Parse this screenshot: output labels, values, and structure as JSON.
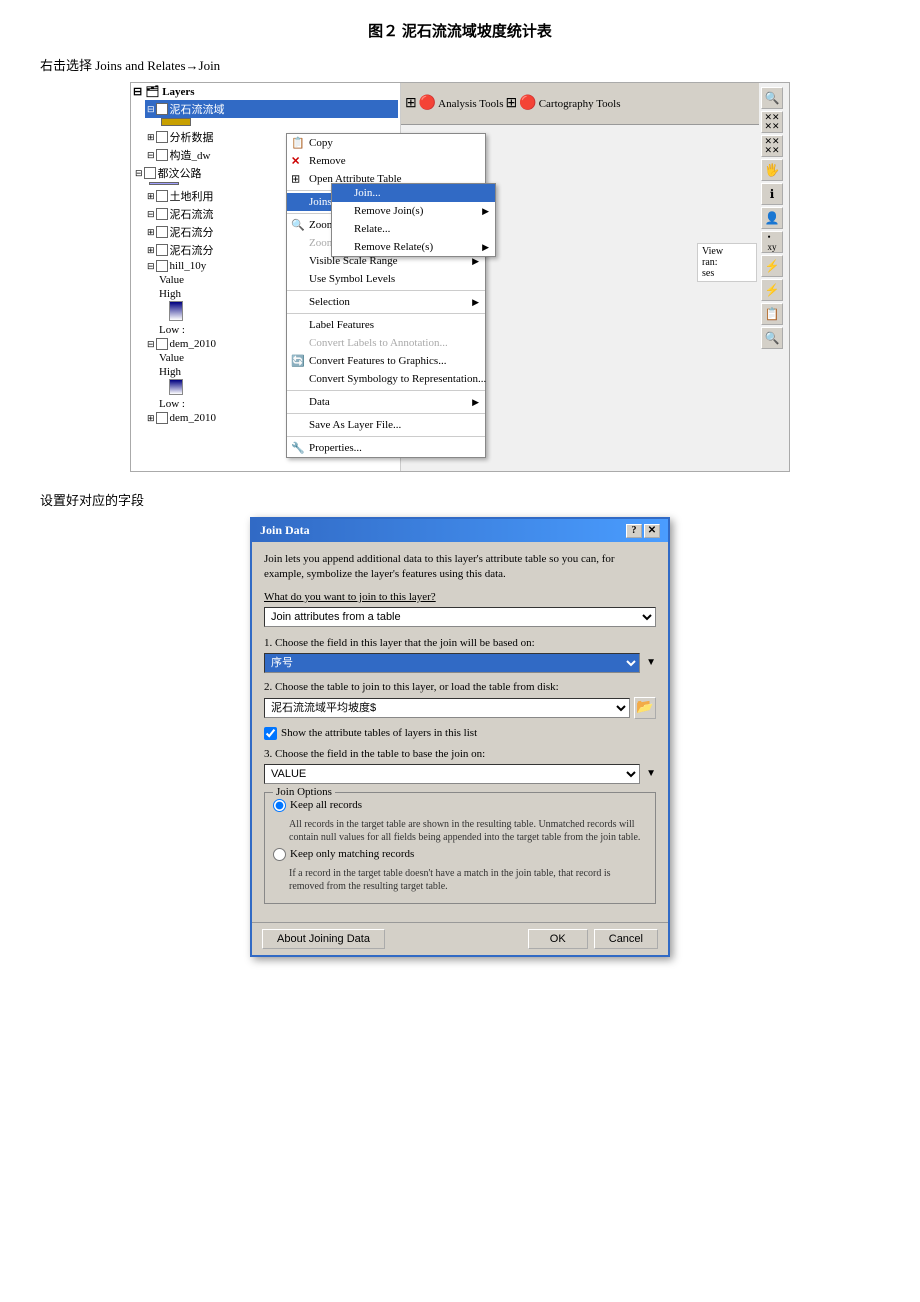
{
  "page": {
    "title": "图２ 泥石流流域坡度统计表",
    "section1_label": "右击选择 Joins and Relates→Join",
    "section2_label": "设置好对应的字段"
  },
  "layers_panel": {
    "title": "Layers",
    "items": [
      {
        "label": "泥石流流域",
        "indent": 1,
        "checked": true,
        "selected": true,
        "type": "layer"
      },
      {
        "label": "分析数据",
        "indent": 1,
        "checked": false,
        "type": "layer"
      },
      {
        "label": "构造_dw",
        "indent": 1,
        "checked": false,
        "type": "layer"
      },
      {
        "label": "都汶公路",
        "indent": 0,
        "checked": false,
        "type": "layer"
      },
      {
        "label": "土地利用",
        "indent": 1,
        "checked": false,
        "type": "layer"
      },
      {
        "label": "泥石流流",
        "indent": 1,
        "checked": false,
        "type": "layer"
      },
      {
        "label": "泥石流分",
        "indent": 1,
        "checked": false,
        "type": "layer"
      },
      {
        "label": "泥石流分",
        "indent": 1,
        "checked": false,
        "type": "layer"
      },
      {
        "label": "hill_10y",
        "indent": 1,
        "checked": false,
        "type": "layer"
      },
      {
        "label": "Value",
        "indent": 2,
        "type": "info"
      },
      {
        "label": "High",
        "indent": 2,
        "type": "info"
      },
      {
        "label": "Low :",
        "indent": 2,
        "type": "info"
      },
      {
        "label": "dem_2010",
        "indent": 1,
        "checked": false,
        "type": "layer"
      },
      {
        "label": "Value",
        "indent": 2,
        "type": "info"
      },
      {
        "label": "High",
        "indent": 2,
        "type": "info"
      },
      {
        "label": "Low :",
        "indent": 2,
        "type": "info"
      },
      {
        "label": "dem_2010",
        "indent": 1,
        "checked": false,
        "type": "layer"
      }
    ]
  },
  "context_menu": {
    "items": [
      {
        "label": "Copy",
        "icon": "📋",
        "disabled": false
      },
      {
        "label": "Remove",
        "icon": "✕",
        "disabled": false
      },
      {
        "label": "Open Attribute Table",
        "icon": "⊞",
        "disabled": false
      },
      {
        "label": "Joins and Relates",
        "icon": "",
        "disabled": false,
        "active": true,
        "has_submenu": true
      },
      {
        "label": "Zoom To Layer",
        "icon": "🔍",
        "disabled": false
      },
      {
        "label": "Zoom To Make Visible",
        "icon": "",
        "disabled": true
      },
      {
        "label": "Visible Scale Range",
        "icon": "",
        "disabled": false,
        "has_submenu": true
      },
      {
        "label": "Use Symbol Levels",
        "icon": "",
        "disabled": false
      },
      {
        "label": "Selection",
        "icon": "",
        "disabled": false,
        "has_submenu": true
      },
      {
        "label": "Label Features",
        "icon": "",
        "disabled": false
      },
      {
        "label": "Convert Labels to Annotation...",
        "icon": "",
        "disabled": true
      },
      {
        "label": "Convert Features to Graphics...",
        "icon": "🔄",
        "disabled": false
      },
      {
        "label": "Convert Symbology to Representation...",
        "icon": "",
        "disabled": false
      },
      {
        "label": "Data",
        "icon": "",
        "disabled": false,
        "has_submenu": true
      },
      {
        "label": "Save As Layer File...",
        "icon": "",
        "disabled": false
      },
      {
        "label": "Properties...",
        "icon": "🔧",
        "disabled": false
      }
    ]
  },
  "submenu": {
    "items": [
      {
        "label": "Join...",
        "active": true
      },
      {
        "label": "Remove Join(s)",
        "has_submenu": true
      },
      {
        "label": "Relate..."
      },
      {
        "label": "Remove Relate(s)",
        "has_submenu": true
      }
    ]
  },
  "dialog": {
    "title": "Join Data",
    "description": "Join lets you append additional data to this layer's attribute table so you can, for example, symbolize the layer's features using this data.",
    "question": "What do you want to join to this layer?",
    "dropdown_value": "Join attributes from a table",
    "step1_label": "1.  Choose the field in this layer that the join will be based on:",
    "step1_field": "序号",
    "step2_label": "2.  Choose the table to join to this layer, or load the table from disk:",
    "step2_field": "泥石流流域平均坡度$",
    "step2_checkbox_label": "Show the attribute tables of layers in this list",
    "step3_label": "3.  Choose the field in the table to base the join on:",
    "step3_field": "VALUE",
    "join_options_title": "Join Options",
    "radio1_label": "Keep all records",
    "radio1_desc": "All records in the target table are shown in the resulting table. Unmatched records will contain null values for all fields being appended into the target table from the join table.",
    "radio2_label": "Keep only matching records",
    "radio2_desc": "If a record in the target table doesn't have a match in the join table, that record is removed from the resulting target table.",
    "btn_about": "About Joining Data",
    "btn_ok": "OK",
    "btn_cancel": "Cancel"
  },
  "toolbar_right": {
    "buttons": [
      "🔍",
      "✕✕",
      "✕✕",
      "✕✕",
      "🖐",
      "ℹ",
      "👤",
      "·xy",
      "⚡",
      "⚡",
      "📋",
      "🔍"
    ]
  },
  "top_toolbar": {
    "items": [
      "Analysis Tools",
      "Cartography Tools"
    ]
  }
}
